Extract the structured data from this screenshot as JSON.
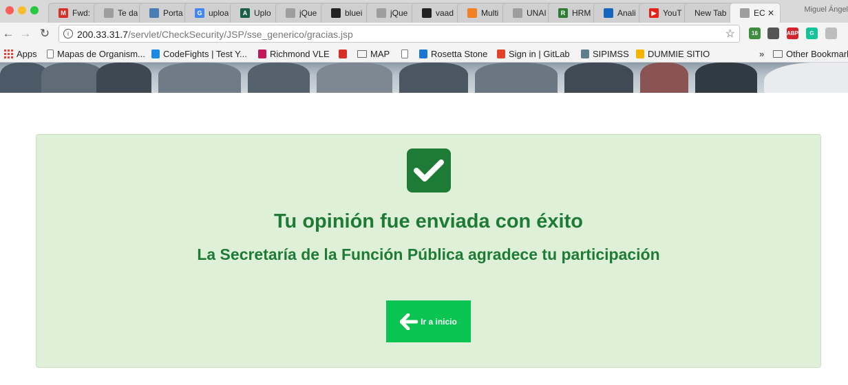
{
  "browser": {
    "tabs": [
      {
        "label": "Fwd:",
        "icon": "gmail-icon",
        "color": "#d93025",
        "glyph": "M"
      },
      {
        "label": "Te da",
        "icon": "page-icon",
        "color": "#9e9e9e",
        "glyph": ""
      },
      {
        "label": "Porta",
        "icon": "portal-icon",
        "color": "#4a7fb5",
        "glyph": ""
      },
      {
        "label": "uploa",
        "icon": "google-icon",
        "color": "#4285f4",
        "glyph": "G"
      },
      {
        "label": "Uplo",
        "icon": "upload-icon",
        "color": "#1b5e4a",
        "glyph": "A"
      },
      {
        "label": "jQue",
        "icon": "document-icon",
        "color": "#9e9e9e",
        "glyph": ""
      },
      {
        "label": "bluei",
        "icon": "github-icon",
        "color": "#222222",
        "glyph": ""
      },
      {
        "label": "jQue",
        "icon": "document-icon",
        "color": "#9e9e9e",
        "glyph": ""
      },
      {
        "label": "vaad",
        "icon": "github-icon",
        "color": "#222222",
        "glyph": ""
      },
      {
        "label": "Multi",
        "icon": "stackoverflow-icon",
        "color": "#f48024",
        "glyph": ""
      },
      {
        "label": "UNAI",
        "icon": "document-icon",
        "color": "#9e9e9e",
        "glyph": ""
      },
      {
        "label": "HRM",
        "icon": "hrm-icon",
        "color": "#2e7d32",
        "glyph": "R"
      },
      {
        "label": "Anali",
        "icon": "analytics-icon",
        "color": "#1565c0",
        "glyph": ""
      },
      {
        "label": "YouT",
        "icon": "youtube-icon",
        "color": "#e62117",
        "glyph": "▶"
      },
      {
        "label": "New Tab",
        "icon": "",
        "color": "",
        "glyph": ""
      },
      {
        "label": "EC",
        "icon": "page-icon",
        "color": "#9e9e9e",
        "glyph": ""
      }
    ],
    "profile_name": "Miguel Ángel",
    "url_host": "200.33.31.7",
    "url_path": "/servlet/CheckSecurity/JSP/sse_generico/gracias.jsp",
    "extensions": [
      {
        "name": "calendar-extension-icon",
        "text": "16",
        "color": "#3f8e3f"
      },
      {
        "name": "dropbox-icon",
        "text": "",
        "color": "#555555"
      },
      {
        "name": "adblock-plus-icon",
        "text": "ABP",
        "color": "#d4232b"
      },
      {
        "name": "grammarly-icon",
        "text": "G",
        "color": "#15c39a"
      },
      {
        "name": "extension-placeholder-icon",
        "text": "",
        "color": "#bdbdbd"
      }
    ],
    "bookmarks": [
      {
        "label": "Apps",
        "type": "apps"
      },
      {
        "label": "Mapas de Organism...",
        "type": "doc"
      },
      {
        "label": "CodeFights | Test Y...",
        "type": "codefights"
      },
      {
        "label": "Richmond VLE",
        "type": "richmond"
      },
      {
        "label": "",
        "type": "gmail"
      },
      {
        "label": "MAP",
        "type": "folder"
      },
      {
        "label": "",
        "type": "doc"
      },
      {
        "label": "Rosetta Stone",
        "type": "rosetta"
      },
      {
        "label": "Sign in | GitLab",
        "type": "gitlab"
      },
      {
        "label": "SIPIMSS",
        "type": "sipimss"
      },
      {
        "label": "DUMMIE SITIO",
        "type": "drive"
      }
    ],
    "bookmarks_overflow": "»",
    "other_bookmarks": "Other Bookmarks"
  },
  "page": {
    "title": "Tu opinión fue enviada con éxito",
    "subtitle": "La Secretaría de la Función Pública agradece tu participación",
    "home_button_label": "Ir a inicio",
    "colors": {
      "success_bg": "#dff0d8",
      "success_text": "#1e7b36",
      "button_bg": "#09c450"
    }
  }
}
